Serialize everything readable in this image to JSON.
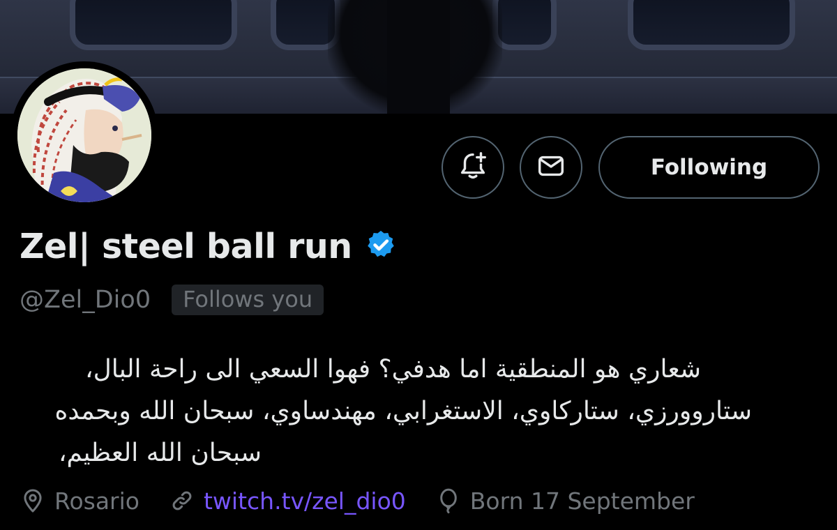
{
  "profile": {
    "display_name": "Zel| steel ball run",
    "handle": "@Zel_Dio0",
    "follows_you_badge": "Follows you",
    "verified_icon": "verified-badge-icon",
    "bio_lines": [
      "شعاري هو المنطقية اما هدفي؟ فهوا السعي الى راحة البال،",
      "ستاروورزي، ستاركاوي، الاستغرابي، مهندساوي، سبحان الله وبحمده",
      "سبحان الله العظيم،"
    ],
    "location": "Rosario",
    "website": "twitch.tv/zel_dio0",
    "birthday": "Born 17 September"
  },
  "actions": {
    "notify_icon": "bell-plus-icon",
    "message_icon": "envelope-icon",
    "follow_label": "Following"
  },
  "icons": {
    "location": "location-pin-icon",
    "link": "link-icon",
    "birthday": "balloon-icon"
  },
  "colors": {
    "background": "#000000",
    "text_primary": "#e7e9ea",
    "text_secondary": "#71767b",
    "border": "#536471",
    "link": "#7856ff",
    "verified": "#1d9bf0"
  }
}
